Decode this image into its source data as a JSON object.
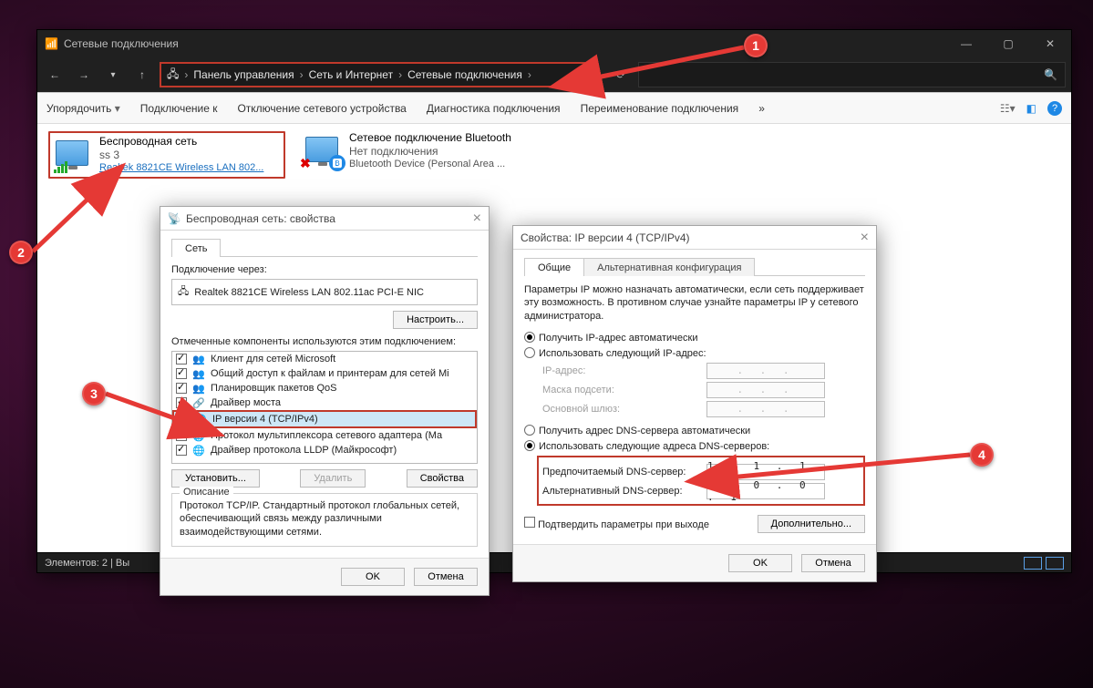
{
  "window": {
    "title": "Сетевые подключения",
    "breadcrumb": [
      "Панель управления",
      "Сеть и Интернет",
      "Сетевые подключения"
    ],
    "cmdbar": {
      "organize": "Упорядочить",
      "connect": "Подключение к",
      "disable": "Отключение сетевого устройства",
      "diagnose": "Диагностика подключения",
      "rename": "Переименование подключения",
      "overflow": "»"
    },
    "connections": [
      {
        "name": "Беспроводная сеть",
        "line2": "ss 3",
        "line3": "Realtek 8821CE Wireless LAN 802..."
      },
      {
        "name": "Сетевое подключение Bluetooth",
        "line2": "Нет подключения",
        "line3": "Bluetooth Device (Personal Area ..."
      }
    ],
    "status": {
      "left": "Элементов: 2  |  Вы"
    }
  },
  "props": {
    "title": "Беспроводная сеть: свойства",
    "tab": "Сеть",
    "connect_via_lbl": "Подключение через:",
    "adapter": "Realtek 8821CE Wireless LAN 802.11ac PCI-E NIC",
    "configure_btn": "Настроить...",
    "components_lbl": "Отмеченные компоненты используются этим подключением:",
    "components": [
      "Клиент для сетей Microsoft",
      "Общий доступ к файлам и принтерам для сетей Mi",
      "Планировщик пакетов QoS",
      "Драйвер моста",
      "IP версии 4 (TCP/IPv4)",
      "Протокол мультиплексора сетевого адаптера (Ма",
      "Драйвер протокола LLDP (Майкрософт)"
    ],
    "install_btn": "Установить...",
    "remove_btn": "Удалить",
    "props_btn": "Свойства",
    "desc_title": "Описание",
    "desc_text": "Протокол TCP/IP. Стандартный протокол глобальных сетей, обеспечивающий связь между различными взаимодействующими сетями.",
    "ok": "OK",
    "cancel": "Отмена"
  },
  "ipv4": {
    "title": "Свойства: IP версии 4 (TCP/IPv4)",
    "tab1": "Общие",
    "tab2": "Альтернативная конфигурация",
    "intro": "Параметры IP можно назначать автоматически, если сеть поддерживает эту возможность. В противном случае узнайте параметры IP у сетевого администратора.",
    "r_ip_auto": "Получить IP-адрес автоматически",
    "r_ip_man": "Использовать следующий IP-адрес:",
    "ip_lbl": "IP-адрес:",
    "mask_lbl": "Маска подсети:",
    "gw_lbl": "Основной шлюз:",
    "r_dns_auto": "Получить адрес DNS-сервера автоматически",
    "r_dns_man": "Использовать следующие адреса DNS-серверов:",
    "dns1_lbl": "Предпочитаемый DNS-сервер:",
    "dns2_lbl": "Альтернативный DNS-сервер:",
    "dns1": "1 . 1 . 1 . 1",
    "dns2": "1 . 0 . 0 . 1",
    "confirm_chk": "Подтвердить параметры при выходе",
    "advanced": "Дополнительно...",
    "ok": "OK",
    "cancel": "Отмена"
  },
  "markers": {
    "m1": "1",
    "m2": "2",
    "m3": "3",
    "m4": "4"
  }
}
